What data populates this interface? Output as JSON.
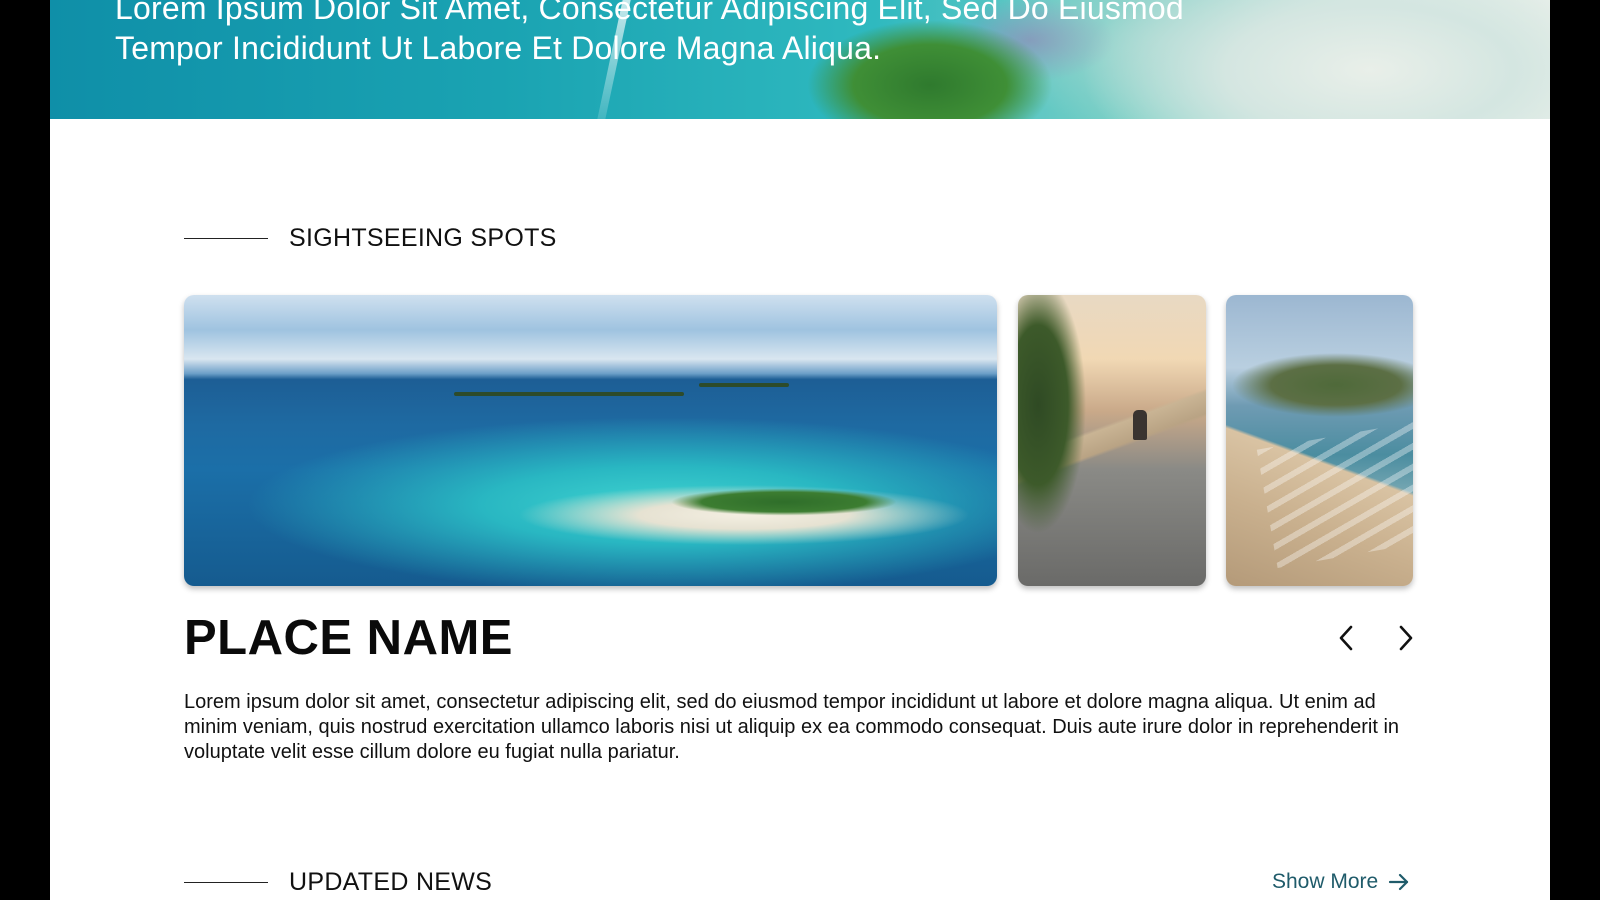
{
  "hero": {
    "tagline": "Lorem Ipsum Dolor Sit Amet, Consectetur Adipiscing Elit, Sed Do Eiusmod Tempor Incididunt Ut Labore Et Dolore Magna Aliqua."
  },
  "sightseeing": {
    "heading": "SIGHTSEEING SPOTS",
    "cards": [
      {
        "name": "atoll-island-image"
      },
      {
        "name": "coastal-seawall-sunset-image"
      },
      {
        "name": "beach-waves-mountain-image"
      }
    ],
    "place_name": "PLACE NAME",
    "description": "Lorem ipsum dolor sit amet, consectetur adipiscing elit, sed do eiusmod tempor incididunt ut labore et dolore magna aliqua. Ut enim ad minim veniam, quis nostrud exercitation ullamco laboris nisi ut aliquip ex ea commodo consequat. Duis aute irure dolor in reprehenderit in voluptate velit esse cillum dolore eu fugiat nulla pariatur.",
    "prev_icon": "chevron-left-icon",
    "next_icon": "chevron-right-icon"
  },
  "news": {
    "heading": "UPDATED NEWS",
    "show_more": "Show More",
    "show_more_icon": "arrow-right-icon"
  },
  "colors": {
    "page_background": "#ffffff",
    "letterbox": "#000000",
    "link": "#1f5b6a",
    "text": "#111111"
  }
}
